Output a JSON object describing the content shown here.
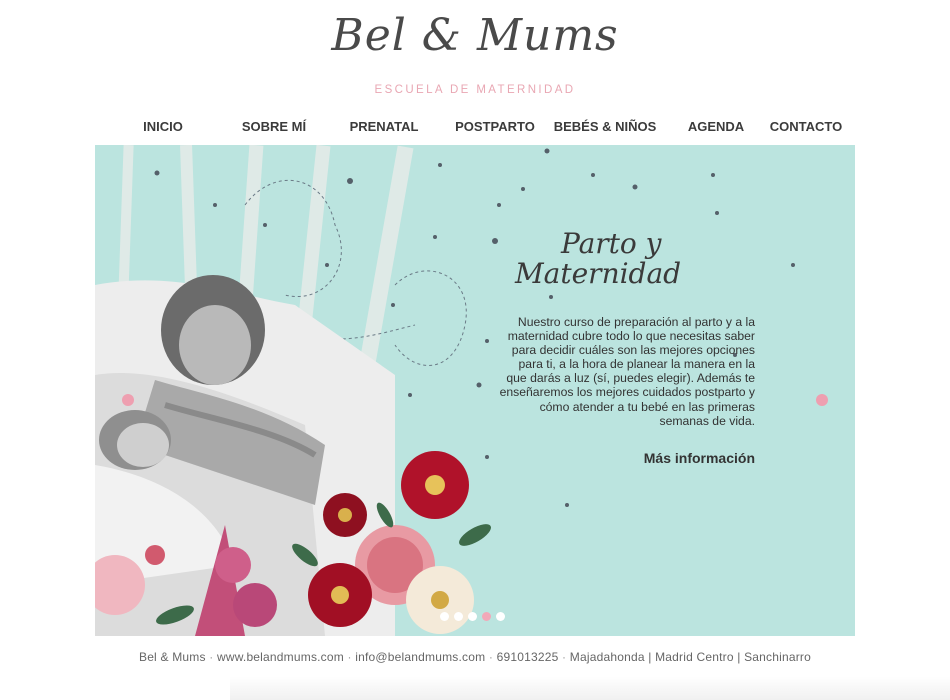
{
  "brand": {
    "name": "Bel & Mums",
    "tagline": "ESCUELA DE MATERNIDAD",
    "accent_color": "#e9a7b3"
  },
  "nav": {
    "items": [
      {
        "label": "INICIO"
      },
      {
        "label": "SOBRE MÍ"
      },
      {
        "label": "PRENATAL"
      },
      {
        "label": "POSTPARTO"
      },
      {
        "label": "BEBÉS & NIÑOS"
      },
      {
        "label": "AGENDA"
      },
      {
        "label": "CONTACTO"
      }
    ]
  },
  "hero": {
    "background_color": "#bbe4df",
    "title_line1": "Parto y",
    "title_line2": "Maternidad",
    "body": "Nuestro curso de preparación al parto y a la maternidad cubre todo lo que necesitas saber para decidir cuáles son las mejores opciones para ti, a la hora de planear la manera en la que darás a luz (sí, puedes elegir). Además te enseñaremos los mejores cuidados postparto y cómo atender a tu bebé en las primeras semanas de vida.",
    "more_link": "Más información",
    "slides_count": 5,
    "active_slide": 4
  },
  "footer": {
    "site": "Bel & Mums",
    "url": "www.belandmums.com",
    "email": "info@belandmums.com",
    "phone": "691013225",
    "locations": "Majadahonda | Madrid Centro | Sanchinarro"
  }
}
